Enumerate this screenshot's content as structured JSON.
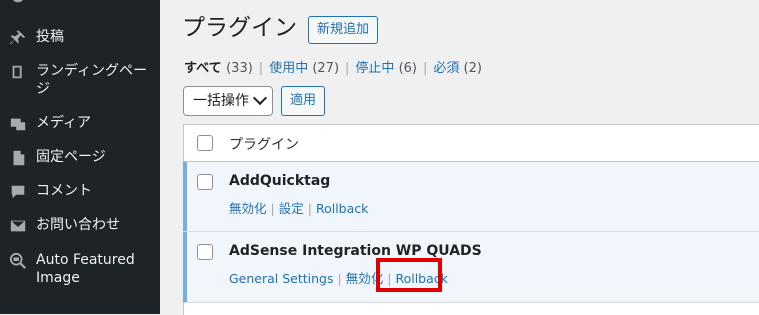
{
  "sidebar": {
    "items": [
      {
        "label": "投稿",
        "icon": "pin-icon"
      },
      {
        "label": "ランディングページ",
        "icon": "book-icon"
      },
      {
        "label": "メディア",
        "icon": "media-icon"
      },
      {
        "label": "固定ページ",
        "icon": "page-icon"
      },
      {
        "label": "コメント",
        "icon": "comment-icon"
      },
      {
        "label": "お問い合わせ",
        "icon": "mail-icon"
      },
      {
        "label": "Auto Featured Image",
        "icon": "image-search-icon"
      }
    ]
  },
  "header": {
    "title": "プラグイン",
    "add_new": "新規追加"
  },
  "filters": {
    "all": {
      "label": "すべて",
      "count": "(33)"
    },
    "active": {
      "label": "使用中",
      "count": "(27)"
    },
    "inactive": {
      "label": "停止中",
      "count": "(6)"
    },
    "required": {
      "label": "必須",
      "count": "(2)"
    }
  },
  "bulk": {
    "selected": "一括操作",
    "apply": "適用"
  },
  "table": {
    "column_header": "プラグイン",
    "rows": [
      {
        "name": "AddQuicktag",
        "actions": [
          "無効化",
          "設定",
          "Rollback"
        ]
      },
      {
        "name": "AdSense Integration WP QUADS",
        "actions": [
          "General Settings",
          "無効化",
          "Rollback"
        ]
      }
    ]
  },
  "colors": {
    "sidebar_bg": "#1d2327",
    "link": "#2271b1",
    "highlight_border": "#e00000",
    "active_row_bar": "#72aee6"
  }
}
